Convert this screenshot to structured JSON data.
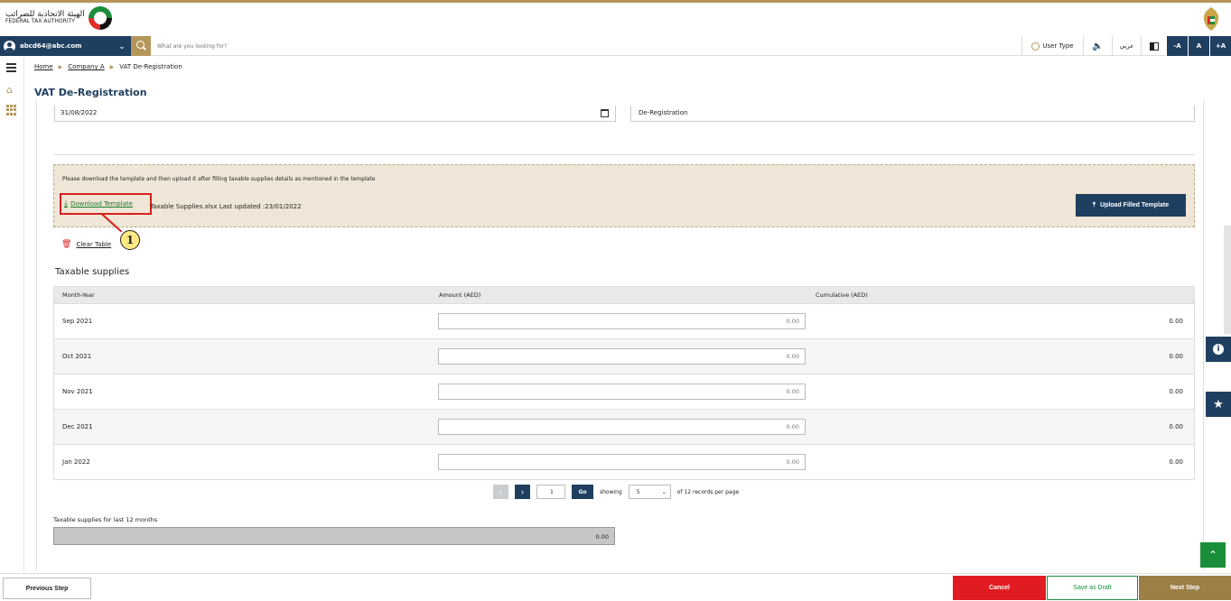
{
  "header": {
    "logo_ar": "الهيئة الاتحادية للضرائب",
    "logo_en": "FEDERAL TAX AUTHORITY"
  },
  "nav": {
    "user_email": "abcd64@abc.com",
    "search_placeholder": "What are you looking for?",
    "user_type": "User Type",
    "arabic": "عربي",
    "font_decrease": "-A",
    "font_normal": "A",
    "font_increase": "+A"
  },
  "breadcrumb": {
    "home": "Home",
    "company": "Company A",
    "current": "VAT De-Registration"
  },
  "page_title": "VAT De-Registration",
  "form": {
    "date": "31/08/2022",
    "type": "De-Registration"
  },
  "template": {
    "message": "Please download the template and then upload it after filling taxable supplies details as mentioned in the template",
    "download_label": "Download Template",
    "file_info": "Taxable Supplies.xlsx Last updated :23/01/2022",
    "upload_label": "Upload Filled Template",
    "callout_number": "1"
  },
  "clear_table_label": "Clear Table",
  "section_title": "Taxable supplies",
  "table": {
    "headers": [
      "Month-Year",
      "Amount (AED)",
      "Cumulative (AED)"
    ],
    "rows": [
      {
        "month": "Sep 2021",
        "amount": "0.00",
        "cumulative": "0.00"
      },
      {
        "month": "Oct 2021",
        "amount": "0.00",
        "cumulative": "0.00"
      },
      {
        "month": "Nov 2021",
        "amount": "0.00",
        "cumulative": "0.00"
      },
      {
        "month": "Dec 2021",
        "amount": "0.00",
        "cumulative": "0.00"
      },
      {
        "month": "Jan 2022",
        "amount": "0.00",
        "cumulative": "0.00"
      }
    ]
  },
  "pager": {
    "page": "1",
    "go": "Go",
    "showing": "showing",
    "per_page": "5",
    "suffix": "of 12 records per page"
  },
  "totals": {
    "label": "Taxable supplies for last 12 months",
    "value": "0.00"
  },
  "footer": {
    "previous": "Previous Step",
    "cancel": "Cancel",
    "save_draft": "Save as Draft",
    "next": "Next Step"
  },
  "colors": {
    "navy": "#1f3f60",
    "gold": "#b4965a",
    "red": "#e11b22",
    "green": "#1a8f3a"
  }
}
